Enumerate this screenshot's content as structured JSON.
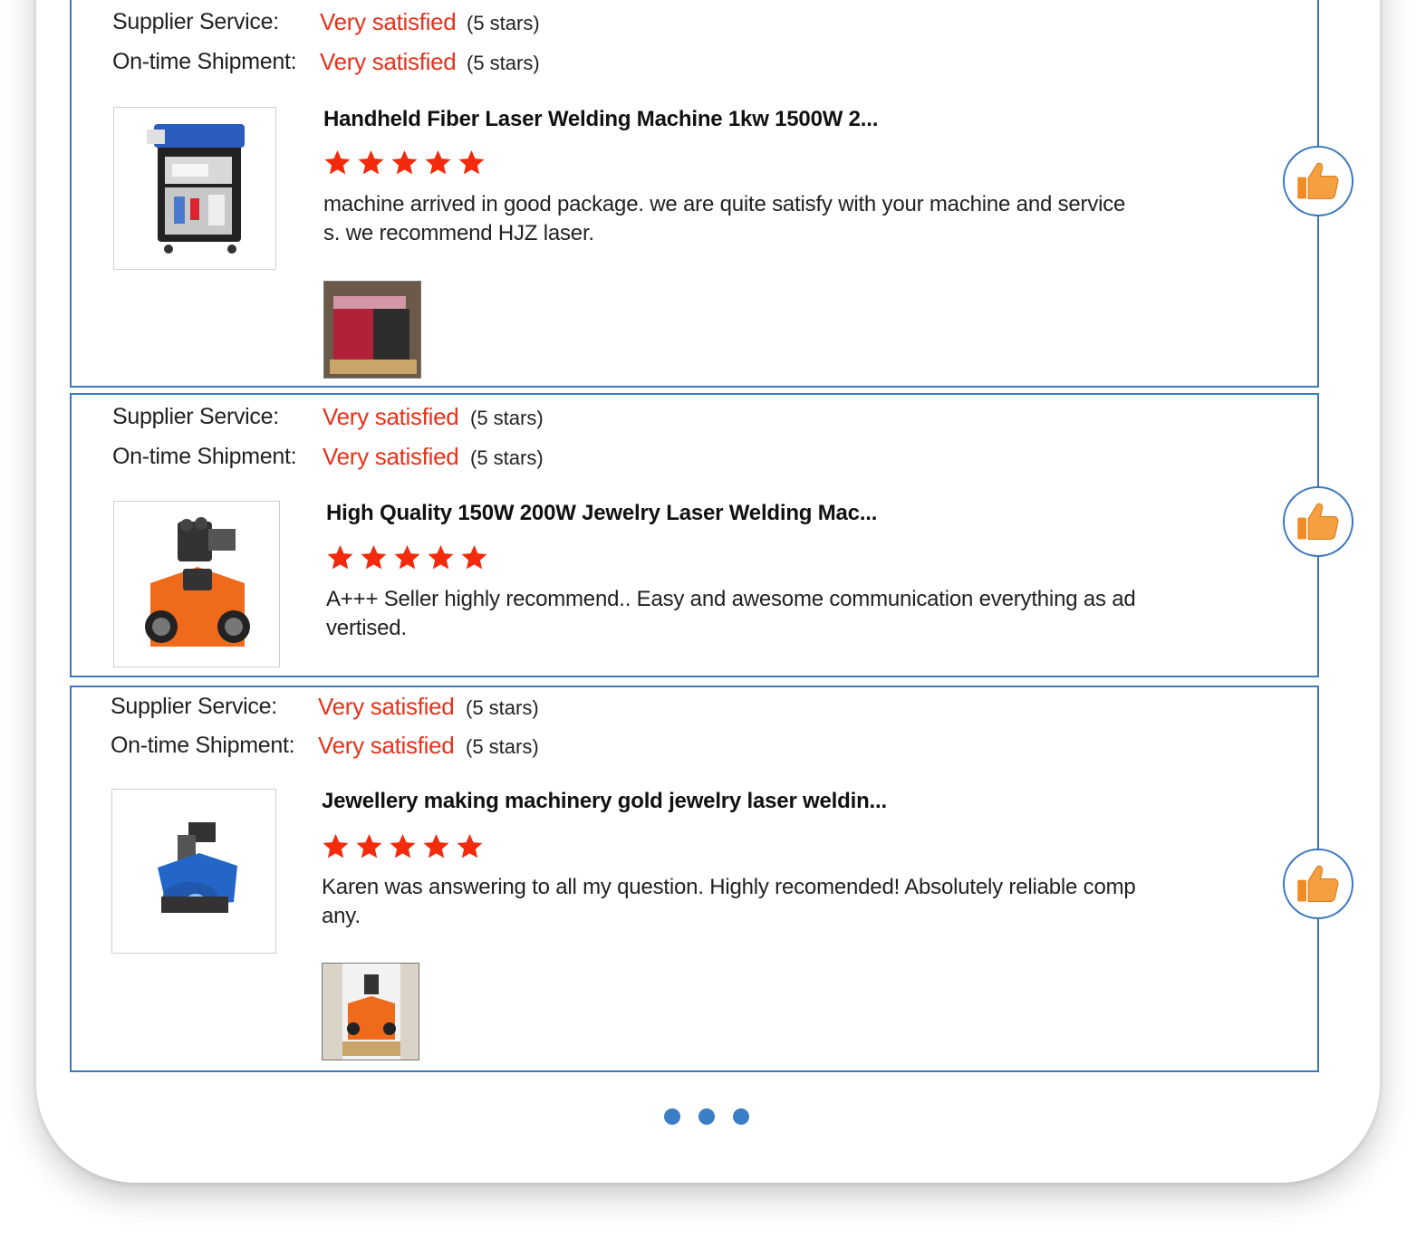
{
  "labels": {
    "supplier_service": "Supplier Service:",
    "ontime_shipment": "On-time Shipment:"
  },
  "colors": {
    "accent_border": "#3a78c0",
    "satisfied_text": "#e8311a",
    "star": "#f32a0c",
    "like_icon": "#f08a24",
    "pager_dot": "#3a7ec6"
  },
  "reviews": [
    {
      "supplier_service": {
        "text": "Very satisfied",
        "stars": "(5 stars)"
      },
      "ontime_shipment": {
        "text": "Very satisfied",
        "stars": "(5 stars)"
      },
      "product_title": "Handheld Fiber Laser Welding Machine 1kw 1500W 2...",
      "rating": 5,
      "review_text": "machine arrived in good package. we are quite satisfy with your machine and services. we recommend HJZ laser.",
      "product_image": "handheld-fiber-laser-welder-image",
      "buyer_photo": "packed-machine-photo",
      "like_icon": "thumbs-up-icon"
    },
    {
      "supplier_service": {
        "text": "Very satisfied",
        "stars": "(5 stars)"
      },
      "ontime_shipment": {
        "text": "Very satisfied",
        "stars": "(5 stars)"
      },
      "product_title": "High Quality 150W 200W Jewelry Laser Welding Mac...",
      "rating": 5,
      "review_text": "A+++ Seller highly recommend.. Easy and awesome communication everything as advertised.",
      "product_image": "orange-jewelry-laser-welder-image",
      "buyer_photo": null,
      "like_icon": "thumbs-up-icon"
    },
    {
      "supplier_service": {
        "text": "Very satisfied",
        "stars": "(5 stars)"
      },
      "ontime_shipment": {
        "text": "Very satisfied",
        "stars": "(5 stars)"
      },
      "product_title": "Jewellery making machinery gold jewelry laser weldin...",
      "rating": 5,
      "review_text": "Karen was answering to all my question. Highly recomended! Absolutely reliable company.",
      "product_image": "blue-jewelry-laser-welder-image",
      "buyer_photo": "orange-welder-on-pallet-photo",
      "like_icon": "thumbs-up-icon"
    }
  ],
  "pagination": {
    "dots": 3
  }
}
